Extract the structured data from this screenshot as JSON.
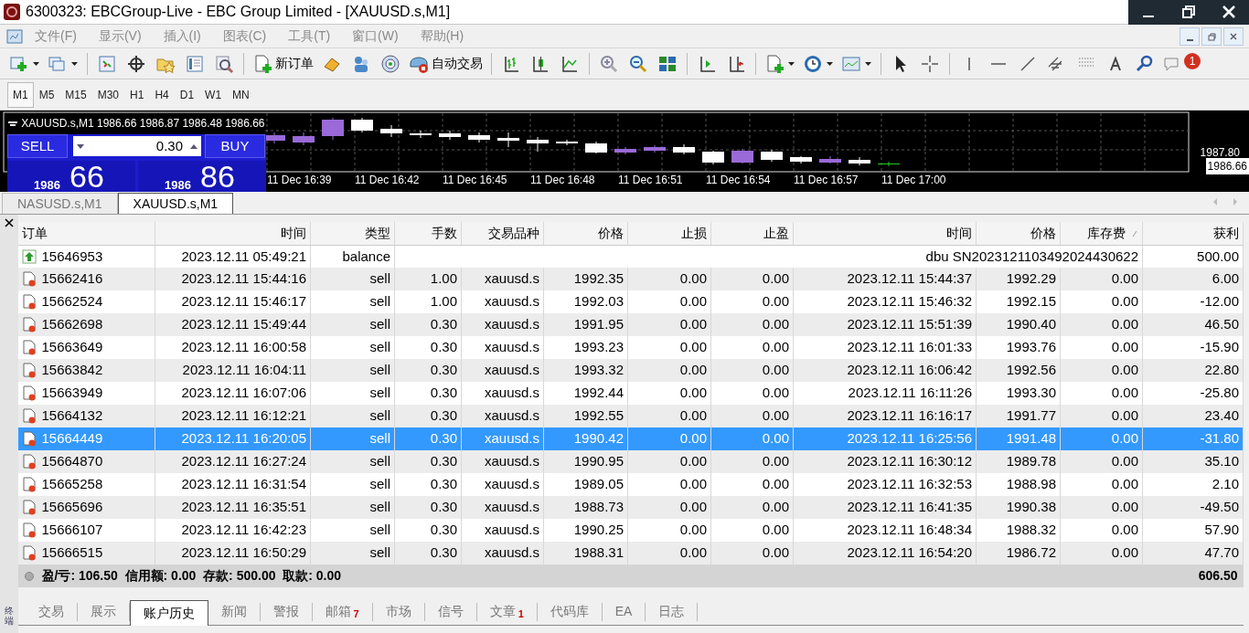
{
  "window": {
    "title": "6300323: EBCGroup-Live - EBC Group Limited - [XAUUSD.s,M1]"
  },
  "menu": [
    {
      "label": "文件(F)"
    },
    {
      "label": "显示(V)"
    },
    {
      "label": "插入(I)"
    },
    {
      "label": "图表(C)"
    },
    {
      "label": "工具(T)"
    },
    {
      "label": "窗口(W)"
    },
    {
      "label": "帮助(H)"
    }
  ],
  "toolbar": {
    "buttons": [
      {
        "label": "新订单"
      },
      {
        "label": "自动交易"
      }
    ],
    "notification_count": "1"
  },
  "timeframes": [
    {
      "label": "M1",
      "selected": true
    },
    {
      "label": "M5",
      "selected": false
    },
    {
      "label": "M15",
      "selected": false
    },
    {
      "label": "M30",
      "selected": false
    },
    {
      "label": "H1",
      "selected": false
    },
    {
      "label": "H4",
      "selected": false
    },
    {
      "label": "D1",
      "selected": false
    },
    {
      "label": "W1",
      "selected": false
    },
    {
      "label": "MN",
      "selected": false
    }
  ],
  "chart": {
    "symbol": "XAUUSD.s,M1",
    "ohlc": "1986.66 1986.87 1986.48 1986.66",
    "trade_panel": {
      "sell_label": "SELL",
      "buy_label": "BUY",
      "lots": "0.30",
      "bid_big": "1986",
      "bid_small": "66",
      "ask_big": "1986",
      "ask_small": "86"
    },
    "time_labels": [
      "11 Dec 16:39",
      "11 Dec 16:42",
      "11 Dec 16:45",
      "11 Dec 16:48",
      "11 Dec 16:51",
      "11 Dec 16:54",
      "11 Dec 16:57",
      "11 Dec 17:00"
    ],
    "price_labels": [
      {
        "text": "1987.80",
        "current": false
      },
      {
        "text": "1986.66",
        "current": true
      }
    ]
  },
  "chart_tabs": [
    {
      "label": "NASUSD.s,M1",
      "selected": false
    },
    {
      "label": "XAUUSD.s,M1",
      "selected": true
    }
  ],
  "terminal": {
    "side_label": "终端",
    "columns": [
      "订单",
      "时间",
      "类型",
      "手数",
      "交易品种",
      "价格",
      "止损",
      "止盈",
      "时间",
      "价格",
      "库存费",
      "获利"
    ],
    "rows": [
      {
        "kind": "balance",
        "selected": false,
        "ticket": "15646953",
        "open_time": "2023.12.11 05:49:21",
        "type": "balance",
        "comment": "dbu SN2023121103492024430622",
        "profit": "500.00"
      },
      {
        "kind": "order",
        "selected": false,
        "ticket": "15662416",
        "open_time": "2023.12.11 15:44:16",
        "type": "sell",
        "lots": "1.00",
        "symbol": "xauusd.s",
        "open_price": "1992.35",
        "sl": "0.00",
        "tp": "0.00",
        "close_time": "2023.12.11 15:44:37",
        "close_price": "1992.29",
        "swap": "0.00",
        "profit": "6.00"
      },
      {
        "kind": "order",
        "selected": false,
        "ticket": "15662524",
        "open_time": "2023.12.11 15:46:17",
        "type": "sell",
        "lots": "1.00",
        "symbol": "xauusd.s",
        "open_price": "1992.03",
        "sl": "0.00",
        "tp": "0.00",
        "close_time": "2023.12.11 15:46:32",
        "close_price": "1992.15",
        "swap": "0.00",
        "profit": "-12.00"
      },
      {
        "kind": "order",
        "selected": false,
        "ticket": "15662698",
        "open_time": "2023.12.11 15:49:44",
        "type": "sell",
        "lots": "0.30",
        "symbol": "xauusd.s",
        "open_price": "1991.95",
        "sl": "0.00",
        "tp": "0.00",
        "close_time": "2023.12.11 15:51:39",
        "close_price": "1990.40",
        "swap": "0.00",
        "profit": "46.50"
      },
      {
        "kind": "order",
        "selected": false,
        "ticket": "15663649",
        "open_time": "2023.12.11 16:00:58",
        "type": "sell",
        "lots": "0.30",
        "symbol": "xauusd.s",
        "open_price": "1993.23",
        "sl": "0.00",
        "tp": "0.00",
        "close_time": "2023.12.11 16:01:33",
        "close_price": "1993.76",
        "swap": "0.00",
        "profit": "-15.90"
      },
      {
        "kind": "order",
        "selected": false,
        "ticket": "15663842",
        "open_time": "2023.12.11 16:04:11",
        "type": "sell",
        "lots": "0.30",
        "symbol": "xauusd.s",
        "open_price": "1993.32",
        "sl": "0.00",
        "tp": "0.00",
        "close_time": "2023.12.11 16:06:42",
        "close_price": "1992.56",
        "swap": "0.00",
        "profit": "22.80"
      },
      {
        "kind": "order",
        "selected": false,
        "ticket": "15663949",
        "open_time": "2023.12.11 16:07:06",
        "type": "sell",
        "lots": "0.30",
        "symbol": "xauusd.s",
        "open_price": "1992.44",
        "sl": "0.00",
        "tp": "0.00",
        "close_time": "2023.12.11 16:11:26",
        "close_price": "1993.30",
        "swap": "0.00",
        "profit": "-25.80"
      },
      {
        "kind": "order",
        "selected": false,
        "ticket": "15664132",
        "open_time": "2023.12.11 16:12:21",
        "type": "sell",
        "lots": "0.30",
        "symbol": "xauusd.s",
        "open_price": "1992.55",
        "sl": "0.00",
        "tp": "0.00",
        "close_time": "2023.12.11 16:16:17",
        "close_price": "1991.77",
        "swap": "0.00",
        "profit": "23.40"
      },
      {
        "kind": "order",
        "selected": true,
        "ticket": "15664449",
        "open_time": "2023.12.11 16:20:05",
        "type": "sell",
        "lots": "0.30",
        "symbol": "xauusd.s",
        "open_price": "1990.42",
        "sl": "0.00",
        "tp": "0.00",
        "close_time": "2023.12.11 16:25:56",
        "close_price": "1991.48",
        "swap": "0.00",
        "profit": "-31.80"
      },
      {
        "kind": "order",
        "selected": false,
        "ticket": "15664870",
        "open_time": "2023.12.11 16:27:24",
        "type": "sell",
        "lots": "0.30",
        "symbol": "xauusd.s",
        "open_price": "1990.95",
        "sl": "0.00",
        "tp": "0.00",
        "close_time": "2023.12.11 16:30:12",
        "close_price": "1989.78",
        "swap": "0.00",
        "profit": "35.10"
      },
      {
        "kind": "order",
        "selected": false,
        "ticket": "15665258",
        "open_time": "2023.12.11 16:31:54",
        "type": "sell",
        "lots": "0.30",
        "symbol": "xauusd.s",
        "open_price": "1989.05",
        "sl": "0.00",
        "tp": "0.00",
        "close_time": "2023.12.11 16:32:53",
        "close_price": "1988.98",
        "swap": "0.00",
        "profit": "2.10"
      },
      {
        "kind": "order",
        "selected": false,
        "ticket": "15665696",
        "open_time": "2023.12.11 16:35:51",
        "type": "sell",
        "lots": "0.30",
        "symbol": "xauusd.s",
        "open_price": "1988.73",
        "sl": "0.00",
        "tp": "0.00",
        "close_time": "2023.12.11 16:41:35",
        "close_price": "1990.38",
        "swap": "0.00",
        "profit": "-49.50"
      },
      {
        "kind": "order",
        "selected": false,
        "ticket": "15666107",
        "open_time": "2023.12.11 16:42:23",
        "type": "sell",
        "lots": "0.30",
        "symbol": "xauusd.s",
        "open_price": "1990.25",
        "sl": "0.00",
        "tp": "0.00",
        "close_time": "2023.12.11 16:48:34",
        "close_price": "1988.32",
        "swap": "0.00",
        "profit": "57.90"
      },
      {
        "kind": "order",
        "selected": false,
        "ticket": "15666515",
        "open_time": "2023.12.11 16:50:29",
        "type": "sell",
        "lots": "0.30",
        "symbol": "xauusd.s",
        "open_price": "1988.31",
        "sl": "0.00",
        "tp": "0.00",
        "close_time": "2023.12.11 16:54:20",
        "close_price": "1986.72",
        "swap": "0.00",
        "profit": "47.70"
      }
    ],
    "summary": {
      "text": "盈/亏: 106.50  信用额: 0.00  存款: 500.00  取款: 0.00",
      "total": "606.50"
    },
    "tabs": [
      {
        "label": "交易",
        "selected": false
      },
      {
        "label": "展示",
        "selected": false
      },
      {
        "label": "账户历史",
        "selected": true
      },
      {
        "label": "新闻",
        "selected": false
      },
      {
        "label": "警报",
        "selected": false
      },
      {
        "label": "邮箱",
        "selected": false,
        "badge": "7"
      },
      {
        "label": "市场",
        "selected": false
      },
      {
        "label": "信号",
        "selected": false
      },
      {
        "label": "文章",
        "selected": false,
        "badge": "1"
      },
      {
        "label": "代码库",
        "selected": false
      },
      {
        "label": "EA",
        "selected": false
      },
      {
        "label": "日志",
        "selected": false
      }
    ]
  }
}
